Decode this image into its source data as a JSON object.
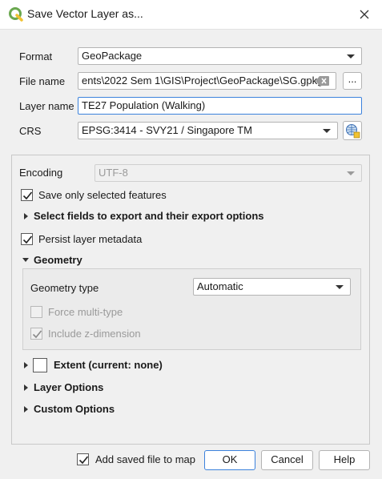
{
  "window": {
    "title": "Save Vector Layer as...",
    "close_icon": "close-icon"
  },
  "form": {
    "format": {
      "label": "Format",
      "value": "GeoPackage"
    },
    "file_name": {
      "label": "File name",
      "value": "ents\\2022 Sem 1\\GIS\\Project\\GeoPackage\\SG.gpkg",
      "browse_label": "..."
    },
    "layer_name": {
      "label": "Layer name",
      "value": "TE27 Population (Walking)"
    },
    "crs": {
      "label": "CRS",
      "value": "EPSG:3414 - SVY21 / Singapore TM"
    }
  },
  "options": {
    "encoding": {
      "label": "Encoding",
      "value": "UTF-8"
    },
    "save_selected": {
      "label": "Save only selected features",
      "checked": true
    },
    "select_fields": {
      "label": "Select fields to export and their export options"
    },
    "persist_metadata": {
      "label": "Persist layer metadata",
      "checked": true
    },
    "geometry": {
      "header": "Geometry",
      "type_label": "Geometry type",
      "type_value": "Automatic",
      "force_multi": {
        "label": "Force multi-type",
        "checked": false
      },
      "include_z": {
        "label": "Include z-dimension",
        "checked": true
      }
    },
    "extent": {
      "label": "Extent (current: none)",
      "checked": false
    },
    "layer_options": {
      "label": "Layer Options"
    },
    "custom_options": {
      "label": "Custom Options"
    }
  },
  "footer": {
    "add_to_map": {
      "label": "Add saved file to map",
      "checked": true
    },
    "ok": "OK",
    "cancel": "Cancel",
    "help": "Help"
  },
  "colors": {
    "accent": "#3c82dc",
    "qgis_green": "#6aa84f"
  }
}
